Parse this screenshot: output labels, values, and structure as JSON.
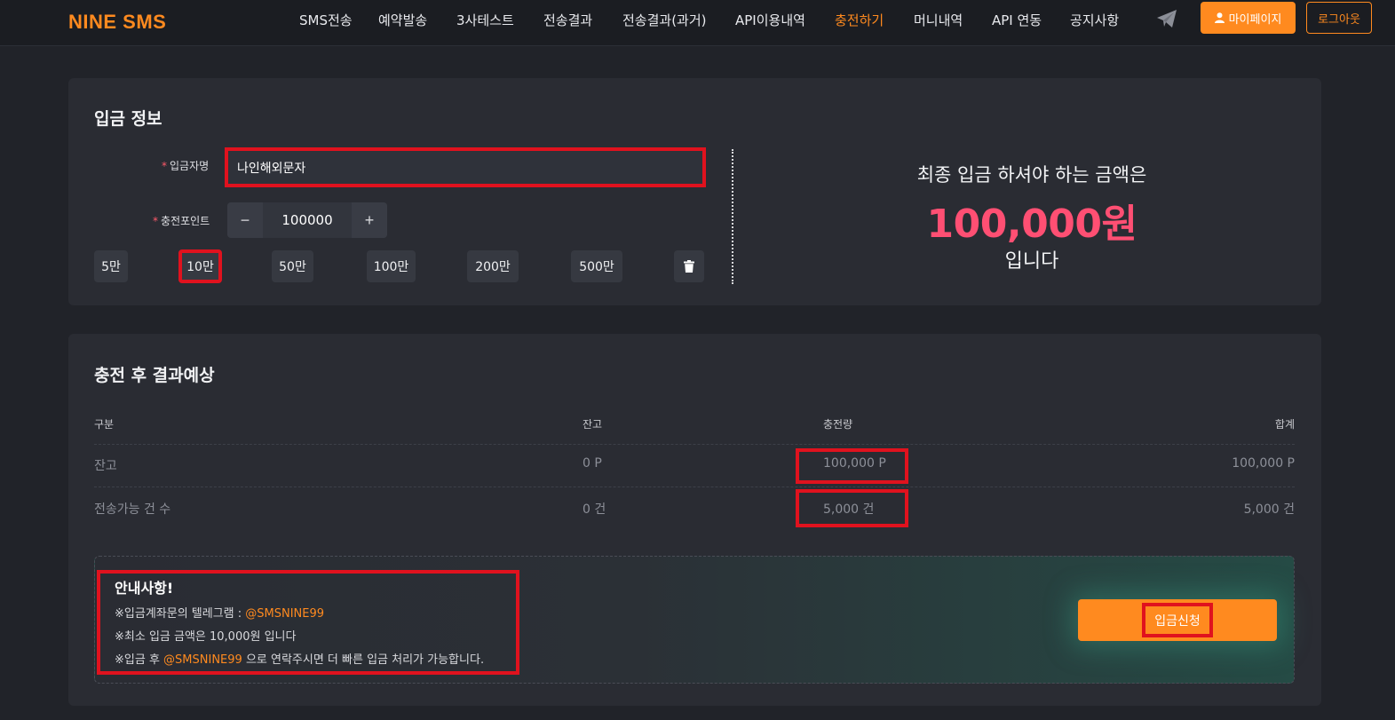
{
  "header": {
    "logo": "NINE SMS",
    "nav": [
      {
        "label": "SMS전송",
        "active": false
      },
      {
        "label": "예약발송",
        "active": false
      },
      {
        "label": "3사테스트",
        "active": false
      },
      {
        "label": "전송결과",
        "active": false
      },
      {
        "label": "전송결과(과거)",
        "active": false
      },
      {
        "label": "API이용내역",
        "active": false
      },
      {
        "label": "충전하기",
        "active": true
      },
      {
        "label": "머니내역",
        "active": false
      },
      {
        "label": "API 연동",
        "active": false
      },
      {
        "label": "공지사항",
        "active": false
      }
    ],
    "mypage_label": "마이페이지",
    "logout_label": "로그아웃"
  },
  "deposit": {
    "title": "입금 정보",
    "required_mark": "*",
    "depositor_label": "입금자명",
    "depositor_value": "나인해외문자",
    "point_label": "충전포인트",
    "point_value": "100000",
    "minus": "−",
    "plus": "+",
    "quick_amounts": [
      "5만",
      "10만",
      "50만",
      "100만",
      "200만",
      "500만"
    ],
    "selected_quick": "10만",
    "final_line1": "최종 입금 하셔야 하는 금액은",
    "final_amount": "100,000원",
    "final_line3": "입니다"
  },
  "result": {
    "title": "충전 후 결과예상",
    "headers": [
      "구분",
      "잔고",
      "충전량",
      "합계"
    ],
    "rows": [
      [
        "잔고",
        "0 P",
        "100,000 P",
        "100,000 P"
      ],
      [
        "전송가능 건 수",
        "0 건",
        "5,000 건",
        "5,000 건"
      ]
    ]
  },
  "notice": {
    "title": "안내사항!",
    "line1_prefix": "※입금계좌문의 텔레그램 : ",
    "line1_handle": "@SMSNINE99",
    "line2": "※최소 입금 금액은 10,000원 입니다",
    "line3_prefix": "※입금 후 ",
    "line3_handle": "@SMSNINE99",
    "line3_suffix": " 으로 연락주시면 더 빠른 입금 처리가 가능합니다.",
    "apply_label": "입금신청"
  },
  "colors": {
    "accent": "#ff8a1f",
    "amount": "#ff4f73",
    "highlight": "#e0121e"
  }
}
